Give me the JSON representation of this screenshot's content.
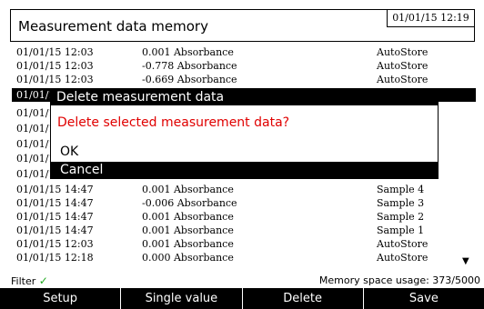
{
  "header": {
    "title": "Measurement data memory",
    "clock": "01/01/15 12:19"
  },
  "rows": [
    {
      "dt": "01/01/15 12:03",
      "val": "0.001 Absorbance",
      "src": "AutoStore"
    },
    {
      "dt": "01/01/15 12:03",
      "val": "-0.778 Absorbance",
      "src": "AutoStore"
    },
    {
      "dt": "01/01/15 12:03",
      "val": "-0.669 Absorbance",
      "src": "AutoStore"
    },
    {
      "dt": "01/01/1",
      "val": "",
      "src": ""
    },
    {
      "dt": "01/01/1",
      "val": "",
      "src": ""
    },
    {
      "dt": "01/01/1",
      "val": "",
      "src": ""
    },
    {
      "dt": "01/01/1",
      "val": "",
      "src": ""
    },
    {
      "dt": "01/01/1",
      "val": "",
      "src": ""
    },
    {
      "dt": "01/01/1",
      "val": "",
      "src": ""
    },
    {
      "dt": "01/01/15 14:47",
      "val": "0.001 Absorbance",
      "src": "Sample 4"
    },
    {
      "dt": "01/01/15 14:47",
      "val": "-0.006 Absorbance",
      "src": "Sample 3"
    },
    {
      "dt": "01/01/15 14:47",
      "val": "0.001 Absorbance",
      "src": "Sample 2"
    },
    {
      "dt": "01/01/15 14:47",
      "val": "0.001 Absorbance",
      "src": "Sample 1"
    },
    {
      "dt": "01/01/15 12:03",
      "val": "0.001 Absorbance",
      "src": "AutoStore"
    },
    {
      "dt": "01/01/15 12:18",
      "val": "0.000 Absorbance",
      "src": "AutoStore"
    }
  ],
  "status": {
    "filter_label": "Filter",
    "filter_check": "✓",
    "memory_usage": "Memory space usage: 373/5000",
    "scroll_icon": "▼"
  },
  "dialog": {
    "title": "Delete measurement data",
    "message": "Delete selected measurement data?",
    "ok": "OK",
    "cancel": "Cancel"
  },
  "buttons": {
    "setup": "Setup",
    "single_value": "Single value",
    "delete": "Delete",
    "save": "Save"
  },
  "colors": {
    "accent": "#000000",
    "warning": "#e00000",
    "check": "#22aa22"
  }
}
